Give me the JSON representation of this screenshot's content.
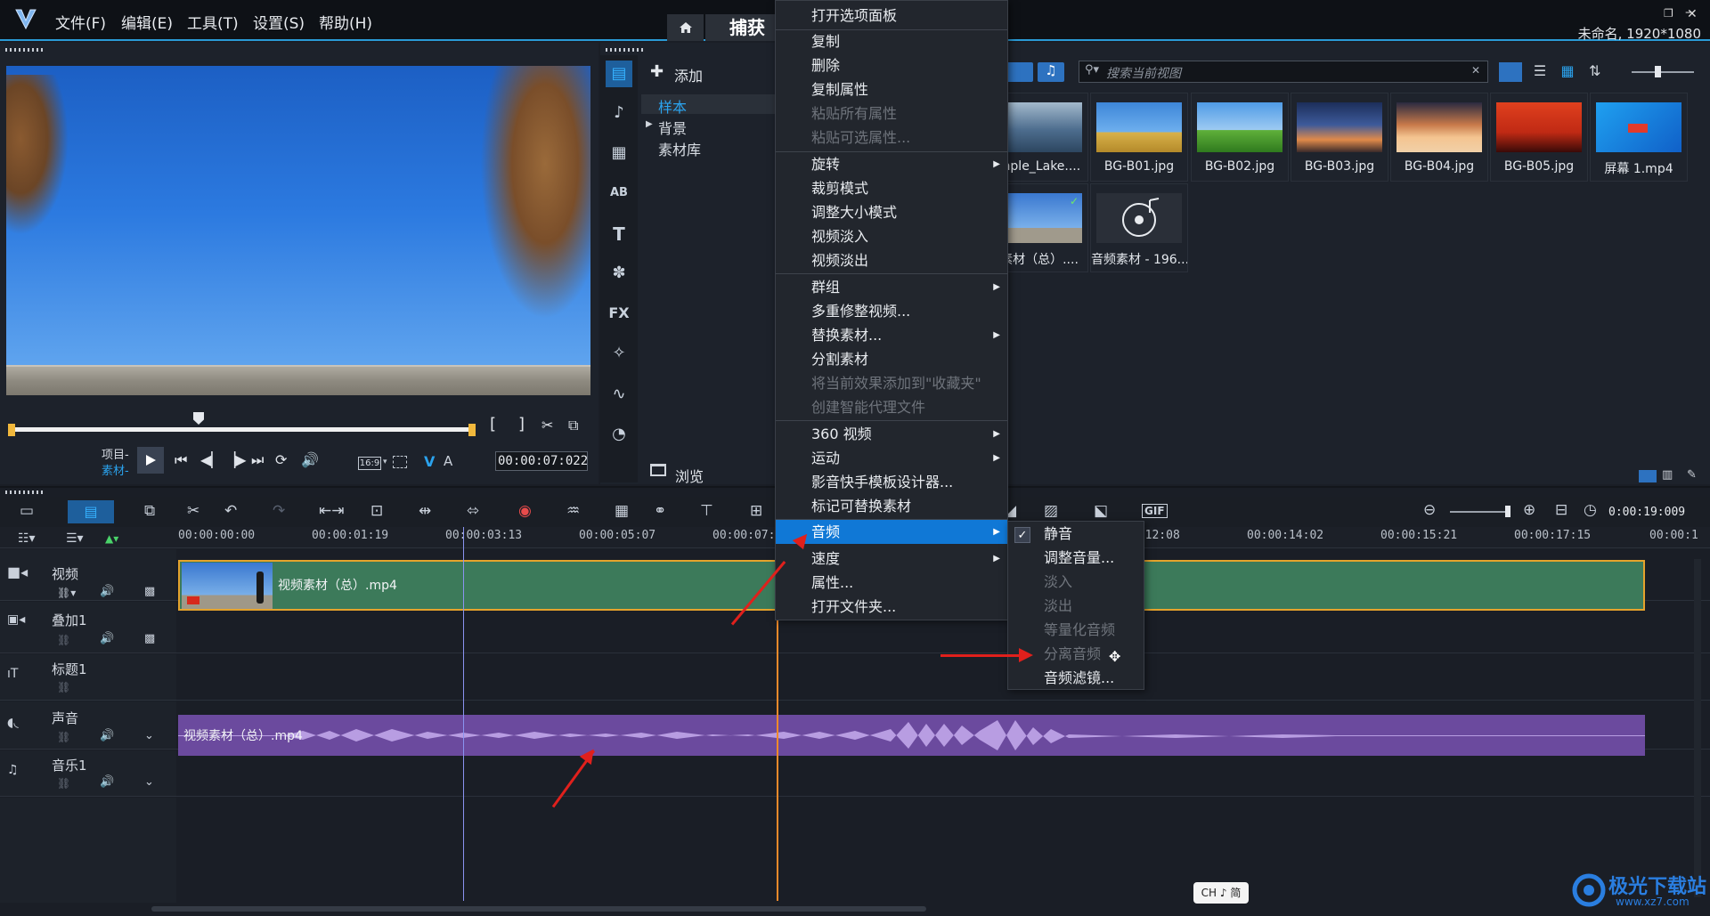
{
  "menubar": {
    "items": [
      "文件(F)",
      "编辑(E)",
      "工具(T)",
      "设置(S)",
      "帮助(H)"
    ]
  },
  "header": {
    "capture_tab": "捕获",
    "project_info": "未命名, 1920*1080"
  },
  "player": {
    "project_label": "项目-",
    "clip_label": "素材-",
    "aspect": "16:9",
    "timecode": "00:00:07:022",
    "text_v": "V",
    "text_a": "A"
  },
  "library": {
    "add_label": "添加",
    "tree": [
      "样本",
      "背景",
      "素材库"
    ],
    "browse_label": "浏览",
    "search_placeholder": "搜索当前视图",
    "thumbnails": [
      {
        "label": "mple_Lake....",
        "color": "#6e8fb0"
      },
      {
        "label": "BG-B01.jpg",
        "color": "#4a8fd4"
      },
      {
        "label": "BG-B02.jpg",
        "color": "#3f9a3c"
      },
      {
        "label": "BG-B03.jpg",
        "color": "#d0603a"
      },
      {
        "label": "BG-B04.jpg",
        "color": "#e4a062"
      },
      {
        "label": "BG-B05.jpg",
        "color": "#c62a1c"
      },
      {
        "label": "屏幕 1.mp4",
        "color": "#1f8fe0"
      },
      {
        "label": "素材（总）....",
        "color": "#5b86c4"
      },
      {
        "label": "音频素材 - 196...",
        "color": "#2a2f38"
      }
    ]
  },
  "context_menu": {
    "items": [
      {
        "label": "打开选项面板",
        "disabled": false,
        "submenu": false
      },
      {
        "label": "复制",
        "disabled": false,
        "submenu": false
      },
      {
        "label": "删除",
        "disabled": false,
        "submenu": false
      },
      {
        "label": "复制属性",
        "disabled": false,
        "submenu": false
      },
      {
        "label": "粘贴所有属性",
        "disabled": true,
        "submenu": false
      },
      {
        "label": "粘贴可选属性...",
        "disabled": true,
        "submenu": false
      },
      {
        "label": "旋转",
        "disabled": false,
        "submenu": true
      },
      {
        "label": "裁剪模式",
        "disabled": false,
        "submenu": false
      },
      {
        "label": "调整大小模式",
        "disabled": false,
        "submenu": false
      },
      {
        "label": "视频淡入",
        "disabled": false,
        "submenu": false
      },
      {
        "label": "视频淡出",
        "disabled": false,
        "submenu": false
      },
      {
        "label": "群组",
        "disabled": false,
        "submenu": true
      },
      {
        "label": "多重修整视频...",
        "disabled": false,
        "submenu": false
      },
      {
        "label": "替换素材...",
        "disabled": false,
        "submenu": true
      },
      {
        "label": "分割素材",
        "disabled": false,
        "submenu": false
      },
      {
        "label": "将当前效果添加到\"收藏夹\"",
        "disabled": true,
        "submenu": false
      },
      {
        "label": "创建智能代理文件",
        "disabled": true,
        "submenu": false
      },
      {
        "label": "360 视频",
        "disabled": false,
        "submenu": true
      },
      {
        "label": "运动",
        "disabled": false,
        "submenu": true
      },
      {
        "label": "影音快手模板设计器...",
        "disabled": false,
        "submenu": false
      },
      {
        "label": "标记可替换素材",
        "disabled": false,
        "submenu": false
      },
      {
        "label": "音频",
        "disabled": false,
        "submenu": true,
        "highlighted": true
      },
      {
        "label": "速度",
        "disabled": false,
        "submenu": true
      },
      {
        "label": "属性...",
        "disabled": false,
        "submenu": false
      },
      {
        "label": "打开文件夹...",
        "disabled": false,
        "submenu": false
      }
    ]
  },
  "audio_submenu": {
    "items": [
      {
        "label": "静音",
        "disabled": false,
        "checked": true
      },
      {
        "label": "调整音量...",
        "disabled": false
      },
      {
        "label": "淡入",
        "disabled": true
      },
      {
        "label": "淡出",
        "disabled": true
      },
      {
        "label": "等量化音频",
        "disabled": true
      },
      {
        "label": "分离音频",
        "disabled": true
      },
      {
        "label": "音频滤镜...",
        "disabled": false
      }
    ]
  },
  "timeline": {
    "duration": "0:00:19:009",
    "ruler": [
      "00:00:00:00",
      "00:00:01:19",
      "00:00:03:13",
      "00:00:05:07",
      "00:00:07:0",
      "0:12:08",
      "00:00:14:02",
      "00:00:15:21",
      "00:00:17:15",
      "00:00:1"
    ],
    "tracks": [
      {
        "name": "视频"
      },
      {
        "name": "叠加1"
      },
      {
        "name": "标题1"
      },
      {
        "name": "声音"
      },
      {
        "name": "音乐1"
      }
    ],
    "video_clip_label": "视频素材（总）.mp4",
    "audio_clip_label": "视频素材（总）.mp4"
  },
  "ime": {
    "label": "CH ♪ 简"
  },
  "watermark": {
    "text": "极光下载站",
    "url_text": "www.xz7.com"
  }
}
